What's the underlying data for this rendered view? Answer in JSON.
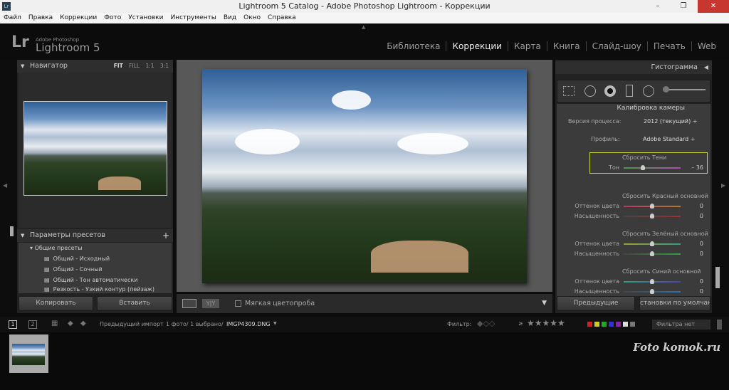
{
  "window": {
    "title": "Lightroom 5 Catalog - Adobe Photoshop Lightroom - Коррекции",
    "minimize": "–",
    "maximize": "❐",
    "close": "✕"
  },
  "menu": [
    "Файл",
    "Правка",
    "Коррекции",
    "Фото",
    "Установки",
    "Инструменты",
    "Вид",
    "Окно",
    "Справка"
  ],
  "logo": {
    "mark": "Lr",
    "sub": "Adobe Photoshop",
    "name": "Lightroom 5"
  },
  "modules": [
    "Библиотека",
    "Коррекции",
    "Карта",
    "Книга",
    "Слайд-шоу",
    "Печать",
    "Web"
  ],
  "active_module": "Коррекции",
  "navigator": {
    "title": "Навигатор",
    "zoom": [
      "FIT",
      "FILL",
      "1:1",
      "3:1"
    ]
  },
  "presets": {
    "title": "Параметры пресетов",
    "add": "+",
    "folder": "Общие пресеты",
    "items": [
      "Общий - Исходный",
      "Общий - Сочный",
      "Общий - Тон автоматически",
      "Резкость - Узкий контур (пейзаж)"
    ]
  },
  "left_buttons": {
    "copy": "Копировать",
    "paste": "Вставить"
  },
  "toolbar": {
    "soft_proof": "Мягкая цветопроба",
    "compare": "Y|Y"
  },
  "right": {
    "histogram": "Гистограмма",
    "section": "Калибровка камеры",
    "process_label": "Версия процесса:",
    "process_value": "2012 (текущий) ÷",
    "profile_label": "Профиль:",
    "profile_value": "Adobe Standard ÷",
    "shadows": {
      "title": "Сбросить Тени",
      "label": "Тон",
      "value": "– 36",
      "level": -36
    },
    "groups": [
      {
        "title": "Сбросить Красный основной",
        "hue_label": "Оттенок цвета",
        "hue": "0",
        "sat_label": "Насыщенность",
        "sat": "0"
      },
      {
        "title": "Сбросить Зелёный основной",
        "hue_label": "Оттенок цвета",
        "hue": "0",
        "sat_label": "Насыщенность",
        "sat": "0"
      },
      {
        "title": "Сбросить Синий основной",
        "hue_label": "Оттенок цвета",
        "hue": "0",
        "sat_label": "Насыщенность",
        "sat": "0"
      }
    ],
    "previous": "Предыдущие",
    "defaults": "становки по умолчанию."
  },
  "filmstrip": {
    "page1": "1",
    "page2": "2",
    "source": "Предыдущий импорт",
    "info": "1 фото/ 1 выбрано/",
    "file": "IMGP4309.DNG",
    "filter_label": "Фильтр:",
    "gte": "≥",
    "stars": "★★★★★",
    "filter_value": "Фильтра нет"
  },
  "colors": {
    "highlight_box": "#c4d630",
    "accent_white": "#eeeeee"
  },
  "watermark": "Foto komok.ru"
}
